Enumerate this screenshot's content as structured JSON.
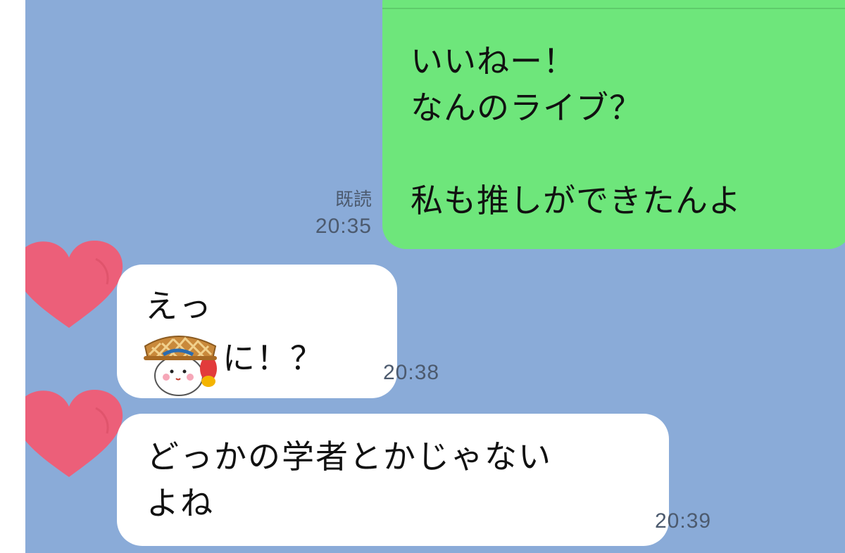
{
  "messages": {
    "outgoing": {
      "lines": "いいねー！\nなんのライブ？\n\n私も推しができたんよ",
      "read_label": "既読",
      "time": "20:35"
    },
    "incoming1": {
      "line1": "えっ",
      "line2_after_sticker": "に！？",
      "time": "20:38",
      "sticker_icon": "cat-with-basket-hat-sticker"
    },
    "incoming2": {
      "lines": "どっかの学者とかじゃない\nよね",
      "time": "20:39"
    }
  },
  "colors": {
    "chat_background": "#8aabd8",
    "outgoing_bubble": "#6ee67b",
    "incoming_bubble": "#ffffff",
    "avatar_heart": "#ec5f79"
  },
  "icons": {
    "avatar": "heart-avatar-icon"
  }
}
